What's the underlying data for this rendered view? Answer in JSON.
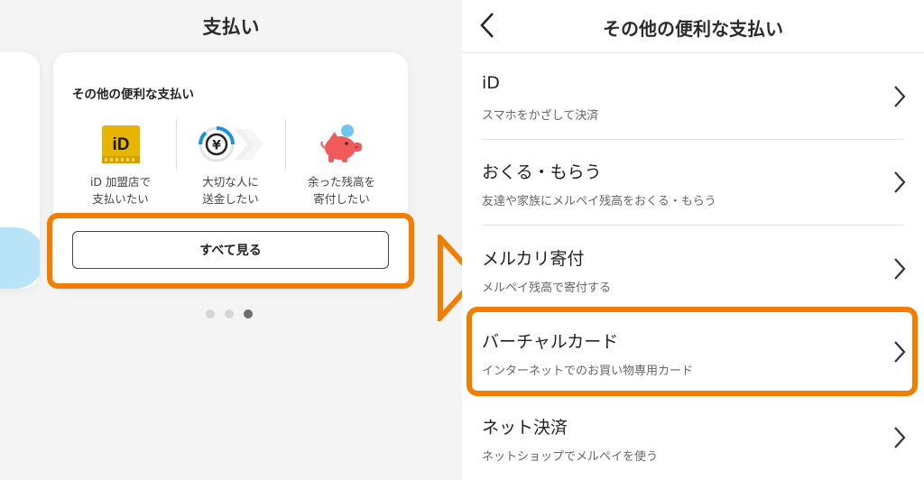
{
  "left": {
    "title": "支払い",
    "card_title": "その他の便利な支払い",
    "features": [
      {
        "icon": "id-logo-icon",
        "icon_text": "iD",
        "label_line1": "iD 加盟店で",
        "label_line2": "支払いたい"
      },
      {
        "icon": "yen-transfer-icon",
        "icon_text": "¥",
        "label_line1": "大切な人に",
        "label_line2": "送金したい"
      },
      {
        "icon": "piggy-bank-icon",
        "label_line1": "余った残高を",
        "label_line2": "寄付したい"
      }
    ],
    "see_all_label": "すべて見る",
    "pager": {
      "count": 3,
      "active": 3
    }
  },
  "right": {
    "title": "その他の便利な支払い",
    "items": [
      {
        "title": "iD",
        "subtitle": "スマホをかざして決済"
      },
      {
        "title": "おくる・もらう",
        "subtitle": "友達や家族にメルペイ残高をおくる・もらう"
      },
      {
        "title": "メルカリ寄付",
        "subtitle": "メルペイ残高で寄付する"
      },
      {
        "title": "バーチャルカード",
        "subtitle": "インターネットでのお買い物専用カード"
      },
      {
        "title": "ネット決済",
        "subtitle": "ネットショップでメルペイを使う"
      }
    ]
  },
  "colors": {
    "highlight": "#f27e00",
    "id_yellow": "#e8b400",
    "transfer_blue": "#1d8fe0",
    "piggy_red": "#f05a5a",
    "coin_blue": "#6ec6f0",
    "peek_blue": "#b9e3f7"
  }
}
